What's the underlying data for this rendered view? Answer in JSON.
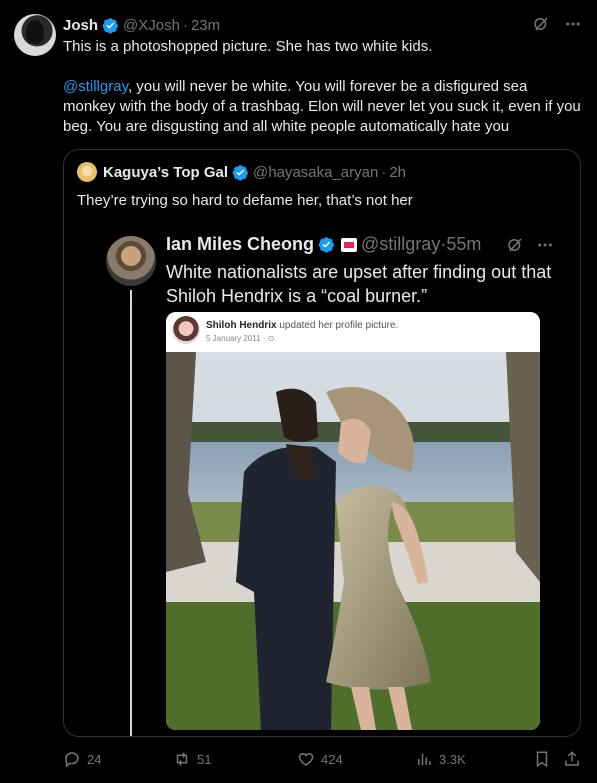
{
  "tweet": {
    "name": "Josh",
    "handle": "@XJosh",
    "time": "23m",
    "line1": "This is a photoshopped picture. She has two white kids.",
    "mention": "@stillgray",
    "line2": ", you will never be white. You will forever be a disfigured sea monkey with the body of a trashbag. Elon will never let you suck it, even if you beg. You are disgusting and all white people automatically hate you"
  },
  "quote": {
    "name": "Kaguya’s Top Gal",
    "handle": "@hayasaka_aryan",
    "time": "2h",
    "text": "They’re trying so hard to defame her, that’s not her"
  },
  "inner": {
    "name": "Ian Miles Cheong",
    "handle": "@stillgray",
    "time": "55m",
    "text": "White nationalists are upset after finding out that Shiloh Hendrix is a “coal burner.”",
    "fb_name": "Shiloh Hendrix",
    "fb_action": " updated her profile picture.",
    "fb_date": "5 January 2011 · "
  },
  "actions": {
    "replies": "24",
    "reposts": "51",
    "likes": "424",
    "views": "3.3K"
  },
  "colors": {
    "accent": "#1d9bf0",
    "muted": "#71767b",
    "text": "#e7e9ea",
    "border": "#2f3336"
  },
  "icons": [
    "verified-icon",
    "grok-icon",
    "more-icon",
    "reply-icon",
    "retweet-icon",
    "like-icon",
    "views-icon",
    "bookmark-icon",
    "share-icon"
  ]
}
